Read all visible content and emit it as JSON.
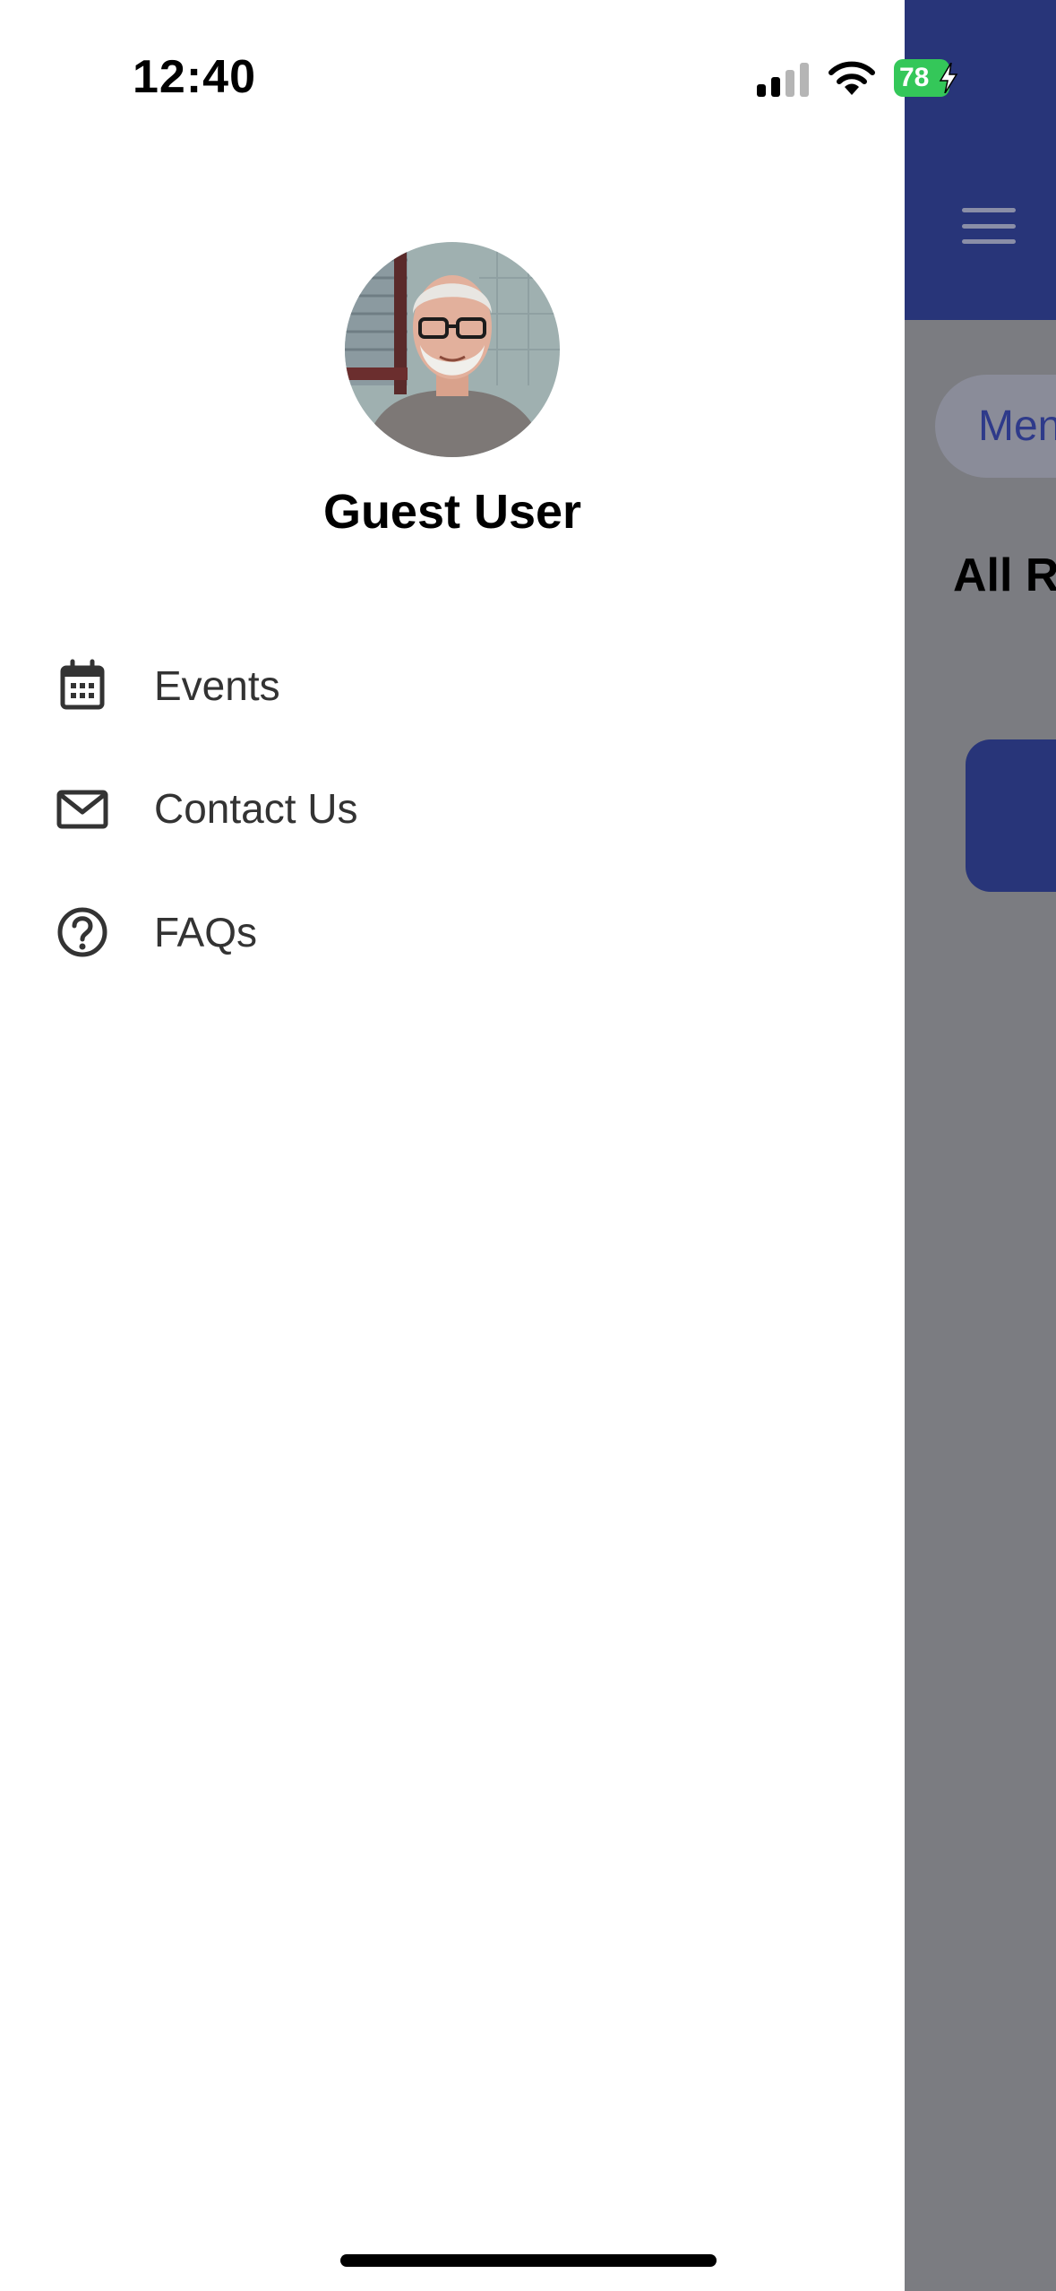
{
  "status_bar": {
    "time": "12:40",
    "battery": "78",
    "battery_color": "#34c759"
  },
  "drawer": {
    "user_name": "Guest User",
    "menu": [
      {
        "label": "Events",
        "icon": "calendar-icon"
      },
      {
        "label": "Contact Us",
        "icon": "mail-icon"
      },
      {
        "label": "FAQs",
        "icon": "question-circle-icon"
      }
    ]
  },
  "background_app": {
    "chip_label": "Men",
    "section_title": "All R",
    "header_color": "#283579"
  }
}
